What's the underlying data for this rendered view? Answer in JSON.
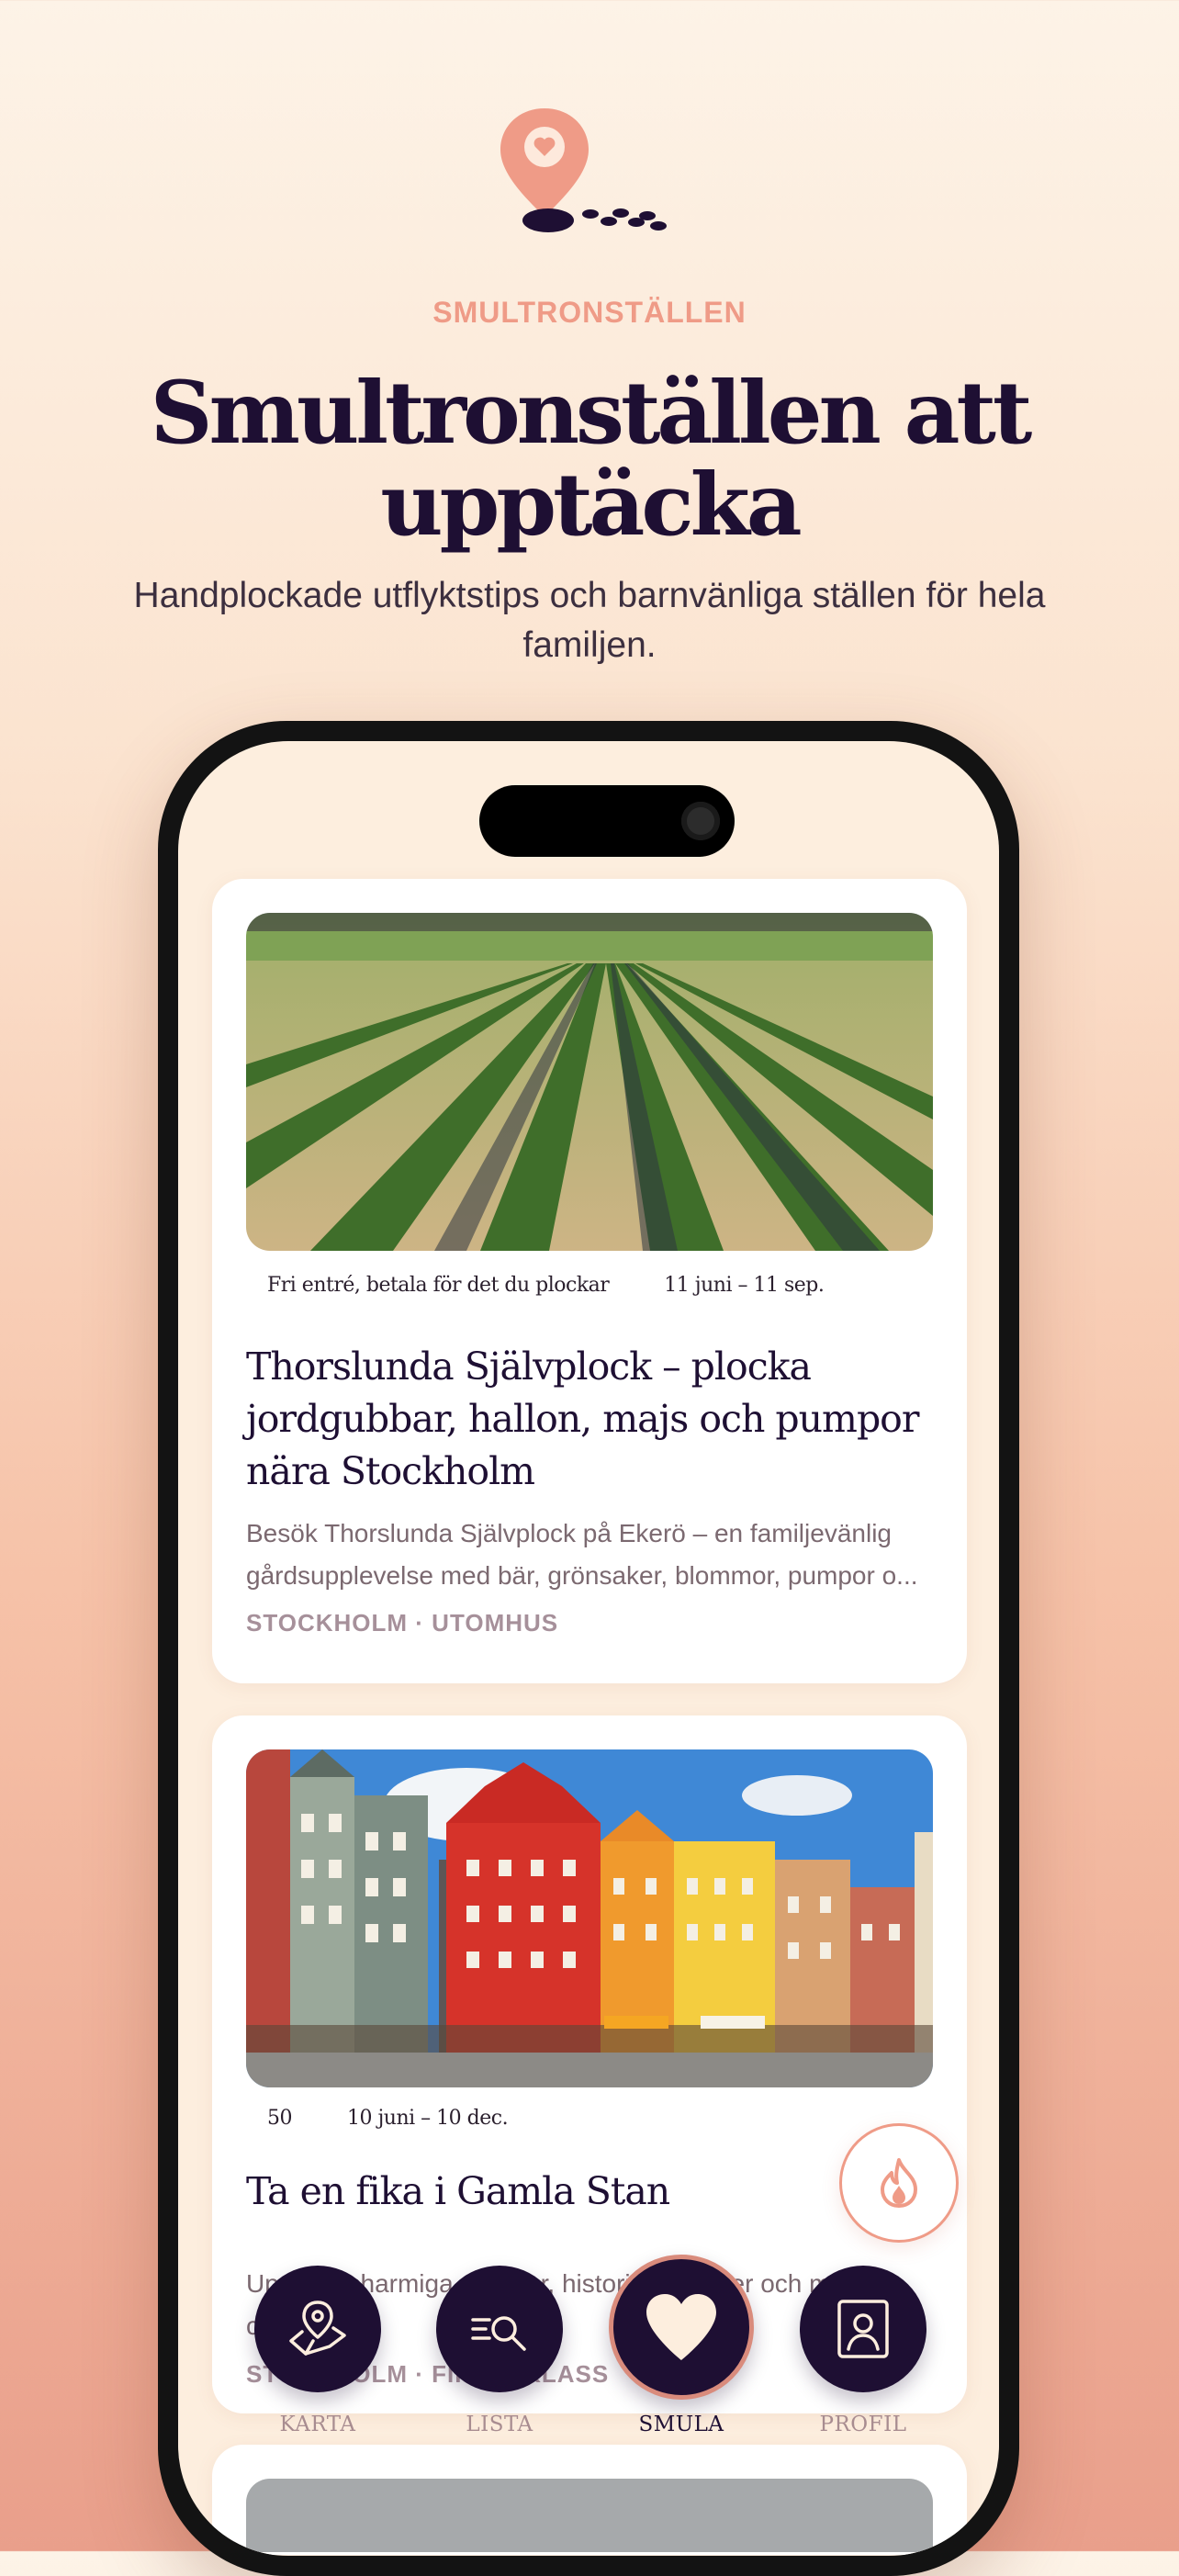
{
  "hero": {
    "eyebrow": "SMULTRONSTÄLLEN",
    "title": "Smultronställen att upptäcka",
    "subtitle": "Handplockade utflyktstips och barnvänliga ställen för hela familjen."
  },
  "cards": [
    {
      "meta_price": "Fri entré, betala för det du plockar",
      "meta_dates": "11 juni – 11 sep.",
      "title": "Thorslunda Självplock – plocka jordgubbar, hallon, majs och pumpor nära Stockholm",
      "desc_line1": "Besök Thorslunda Självplock på Ekerö – en familjevänlig",
      "desc_line2": "gårdsupplevelse med bär, grönsaker, blommor, pumpor o...",
      "tags": "STOCKHOLM · UTOMHUS",
      "image": "strawberry-field-photo"
    },
    {
      "meta_price": "50",
      "meta_dates": "10 juni – 10 dec.",
      "title": "Ta en fika i Gamla Stan",
      "desc_line1": "Upptäck charmiga gränder, historiska miljöer och mysiga",
      "desc_line2": "ca",
      "tags": "STOCKHOLM · FIKA & KLASS",
      "image": "gamla-stan-photo"
    }
  ],
  "nav": {
    "items": [
      {
        "label": "KARTA",
        "icon": "map-pin-icon"
      },
      {
        "label": "LISTA",
        "icon": "list-search-icon"
      },
      {
        "label": "SMULA",
        "icon": "heart-icon"
      },
      {
        "label": "PROFIL",
        "icon": "profile-icon"
      }
    ],
    "active": "SMULA"
  },
  "colors": {
    "accent": "#ef9b87",
    "ink": "#1e0f33",
    "nav_bg": "#1e0f33"
  }
}
